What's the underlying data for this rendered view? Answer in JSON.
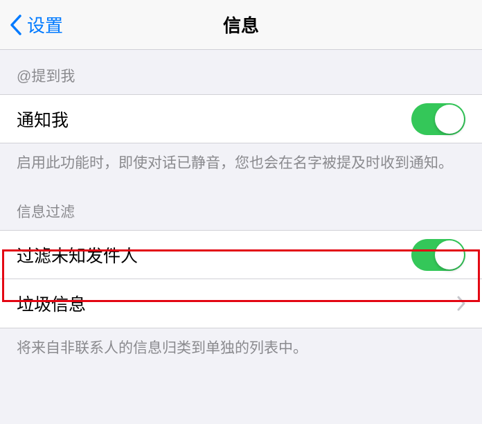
{
  "nav": {
    "back_label": "设置",
    "title": "信息"
  },
  "section1": {
    "header": "@提到我",
    "notify": {
      "label": "通知我",
      "enabled": true
    },
    "footer": "启用此功能时，即使对话已静音，您也会在名字被提及时收到通知。"
  },
  "section2": {
    "header": "信息过滤",
    "filter_unknown": {
      "label": "过滤未知发件人",
      "enabled": true
    },
    "junk": {
      "label": "垃圾信息"
    },
    "footer": "将来自非联系人的信息归类到单独的列表中。"
  }
}
